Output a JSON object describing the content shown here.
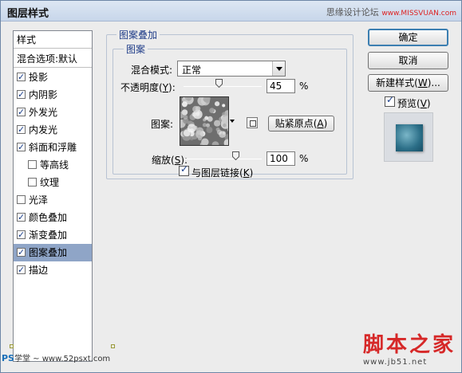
{
  "window": {
    "title": "图层样式",
    "watermark_top": "思缘设计论坛",
    "watermark_top_site": "www.MISSVUAN.com"
  },
  "styles_list": {
    "header": "样式",
    "blend_options": "混合选项:默认",
    "items": [
      {
        "label": "投影",
        "checked": true,
        "indent": false,
        "selected": false
      },
      {
        "label": "内阴影",
        "checked": true,
        "indent": false,
        "selected": false
      },
      {
        "label": "外发光",
        "checked": true,
        "indent": false,
        "selected": false
      },
      {
        "label": "内发光",
        "checked": true,
        "indent": false,
        "selected": false
      },
      {
        "label": "斜面和浮雕",
        "checked": true,
        "indent": false,
        "selected": false
      },
      {
        "label": "等高线",
        "checked": false,
        "indent": true,
        "selected": false
      },
      {
        "label": "纹理",
        "checked": false,
        "indent": true,
        "selected": false
      },
      {
        "label": "光泽",
        "checked": false,
        "indent": false,
        "selected": false
      },
      {
        "label": "颜色叠加",
        "checked": true,
        "indent": false,
        "selected": false
      },
      {
        "label": "渐变叠加",
        "checked": true,
        "indent": false,
        "selected": false
      },
      {
        "label": "图案叠加",
        "checked": true,
        "indent": false,
        "selected": true
      },
      {
        "label": "描边",
        "checked": true,
        "indent": false,
        "selected": false
      }
    ]
  },
  "pattern_overlay": {
    "section_title": "图案叠加",
    "group_title": "图案",
    "blend_mode_label": "混合模式:",
    "blend_mode_value": "正常",
    "opacity_label": "不透明度(",
    "opacity_key": "Y",
    "opacity_label_end": "):",
    "opacity_value": "45",
    "opacity_percent": 45,
    "pattern_label": "图案:",
    "snap_button": "贴紧原点(",
    "snap_key": "A",
    "snap_end": ")",
    "scale_label": "缩放(",
    "scale_key": "S",
    "scale_label_end": "):",
    "scale_value": "100",
    "scale_percent": 100,
    "link_label": "与图层链接(",
    "link_key": "K",
    "link_end": ")",
    "link_checked": true,
    "percent_sign": "%"
  },
  "buttons": {
    "ok": "确定",
    "cancel": "取消",
    "new_style": "新建样式(",
    "new_style_key": "W",
    "new_style_end": ")...",
    "preview_label": "预览(",
    "preview_key": "V",
    "preview_end": ")",
    "preview_checked": true
  },
  "watermarks": {
    "bottom_left_ps": "PS",
    "bottom_left_text": "学堂 ~ www.52psxt.com",
    "bottom_right_big": "脚本之家",
    "bottom_right_url": "www.jb51.net"
  },
  "colors": {
    "selected_row": "#8fa5c7",
    "group_title": "#1f3c88",
    "default_button_border": "#3c7fb1"
  }
}
